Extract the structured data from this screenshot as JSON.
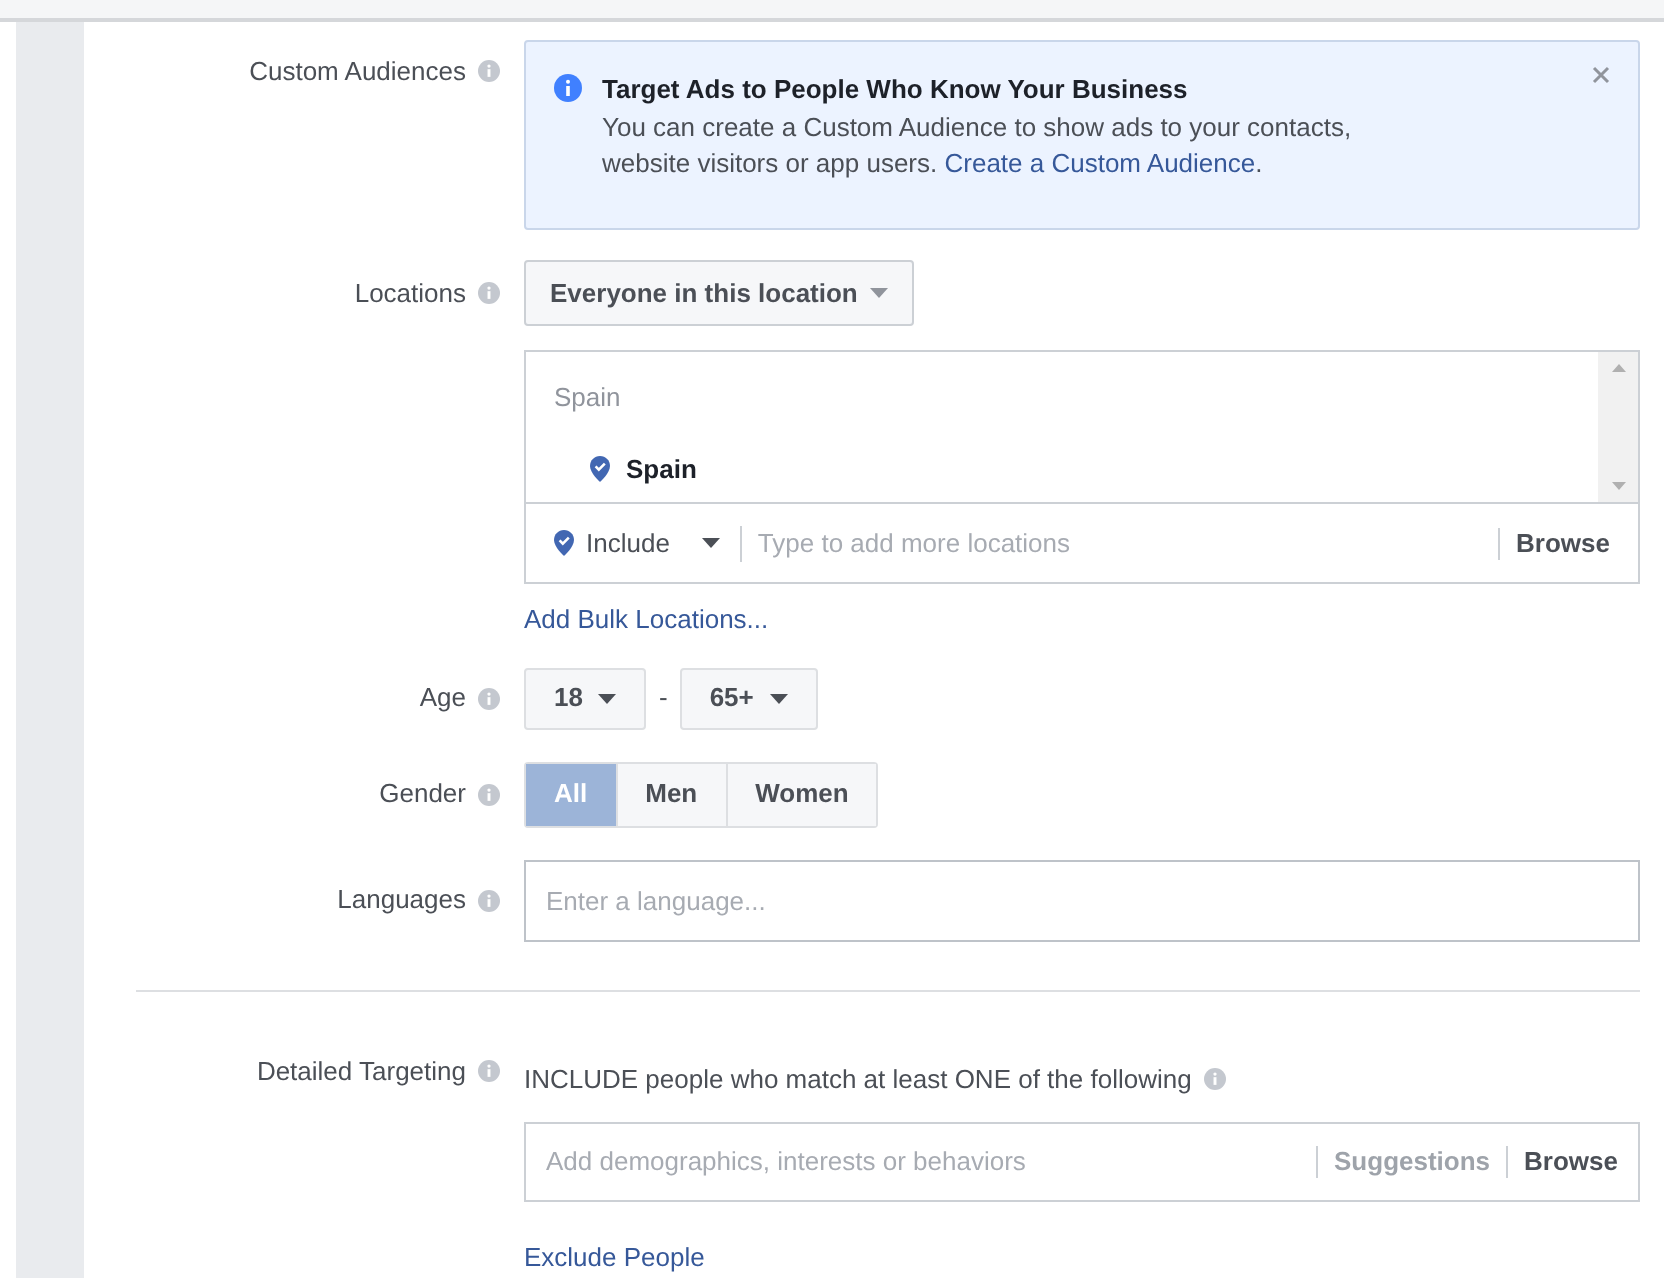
{
  "custom_audiences": {
    "label": "Custom Audiences",
    "notice": {
      "title": "Target Ads to People Who Know Your Business",
      "body": "You can create a Custom Audience to show ads to your contacts, website visitors or app users.",
      "link": "Create a Custom Audience",
      "link_suffix": "."
    }
  },
  "locations": {
    "label": "Locations",
    "dropdown": "Everyone in this location",
    "group": "Spain",
    "selected": "Spain",
    "mode": "Include",
    "placeholder": "Type to add more locations",
    "browse": "Browse",
    "bulk_link": "Add Bulk Locations..."
  },
  "age": {
    "label": "Age",
    "min": "18",
    "separator": "-",
    "max": "65+"
  },
  "gender": {
    "label": "Gender",
    "options": [
      {
        "label": "All",
        "selected": true
      },
      {
        "label": "Men",
        "selected": false
      },
      {
        "label": "Women",
        "selected": false
      }
    ]
  },
  "languages": {
    "label": "Languages",
    "placeholder": "Enter a language..."
  },
  "detailed_targeting": {
    "label": "Detailed Targeting",
    "heading": "INCLUDE people who match at least ONE of the following",
    "placeholder": "Add demographics, interests or behaviors",
    "suggestions": {
      "label": "Suggestions",
      "disabled": true
    },
    "browse": "Browse",
    "exclude_link": "Exclude People"
  }
}
